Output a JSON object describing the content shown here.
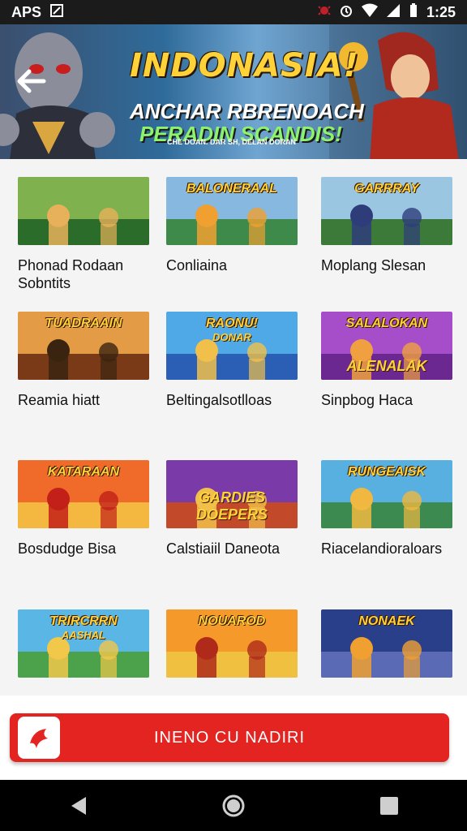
{
  "status_bar": {
    "left_text": "APS",
    "time": "1:25"
  },
  "banner": {
    "title": "INDONASIA!",
    "line1": "ANCHAR RBRENOACH",
    "line2": "PERADIN SCANDIS!",
    "small": "CHE DOAN. DAR SH, DELAN DORAN"
  },
  "games": [
    {
      "label": "Phonad Rodaan Sobntits",
      "thumb_top": "",
      "thumb_sub": "",
      "thumb_bottom": "",
      "colors": [
        "#7fb24e",
        "#2c6c2a",
        "#e7b05a"
      ]
    },
    {
      "label": "Conliaina",
      "thumb_top": "BALONERAAL",
      "thumb_sub": "",
      "thumb_bottom": "",
      "colors": [
        "#86b8e0",
        "#3e8a4a",
        "#f0a030"
      ]
    },
    {
      "label": "Moplang Slesan",
      "thumb_top": "GARRRAY",
      "thumb_sub": "",
      "thumb_bottom": "",
      "colors": [
        "#9ac6e2",
        "#3c7a3a",
        "#2e3d7a"
      ]
    },
    {
      "label": "Reamia hiatt",
      "thumb_top": "TUADRAAIN",
      "thumb_sub": "",
      "thumb_bottom": "",
      "colors": [
        "#e49b45",
        "#7a3a18",
        "#3a2410"
      ]
    },
    {
      "label": "Beltingalsotlloas",
      "thumb_top": "RAONU!",
      "thumb_sub": "DONAR",
      "thumb_bottom": "",
      "colors": [
        "#4fa9e6",
        "#2a5fb5",
        "#f1c04a"
      ]
    },
    {
      "label": "Sinpbog Haca",
      "thumb_top": "SALALOKAN",
      "thumb_sub": "",
      "thumb_bottom": "ALENALAK",
      "colors": [
        "#a64ec9",
        "#6a2890",
        "#f0a040"
      ]
    },
    {
      "label": "Bosdudge Bisa",
      "thumb_top": "KATARAAN",
      "thumb_sub": "",
      "thumb_bottom": "",
      "colors": [
        "#f06a2a",
        "#f4b840",
        "#c22018"
      ]
    },
    {
      "label": "Calstiaiil Daneota",
      "thumb_top": "",
      "thumb_sub": "",
      "thumb_bottom": "GARDIES DOEPERS",
      "colors": [
        "#7a3aa8",
        "#c24a2a",
        "#f1c04a"
      ]
    },
    {
      "label": "Riacelandioraloars",
      "thumb_top": "RUNGEAISK",
      "thumb_sub": "",
      "thumb_bottom": "",
      "colors": [
        "#58b0e0",
        "#3c8a50",
        "#f0b840"
      ]
    },
    {
      "label": "",
      "thumb_top": "TRIRCRRN",
      "thumb_sub": "AASHAL",
      "thumb_bottom": "",
      "colors": [
        "#5ab6e4",
        "#4ca24a",
        "#f2c84a"
      ]
    },
    {
      "label": "",
      "thumb_top": "NOUAROD",
      "thumb_sub": "",
      "thumb_bottom": "",
      "colors": [
        "#f59a2a",
        "#f0c040",
        "#b02a1a"
      ]
    },
    {
      "label": "",
      "thumb_top": "NONAEK",
      "thumb_sub": "",
      "thumb_bottom": "",
      "colors": [
        "#2a3f8a",
        "#5a6ab5",
        "#f0a030"
      ]
    }
  ],
  "cta": {
    "label": "INENO CU NADIRI"
  }
}
